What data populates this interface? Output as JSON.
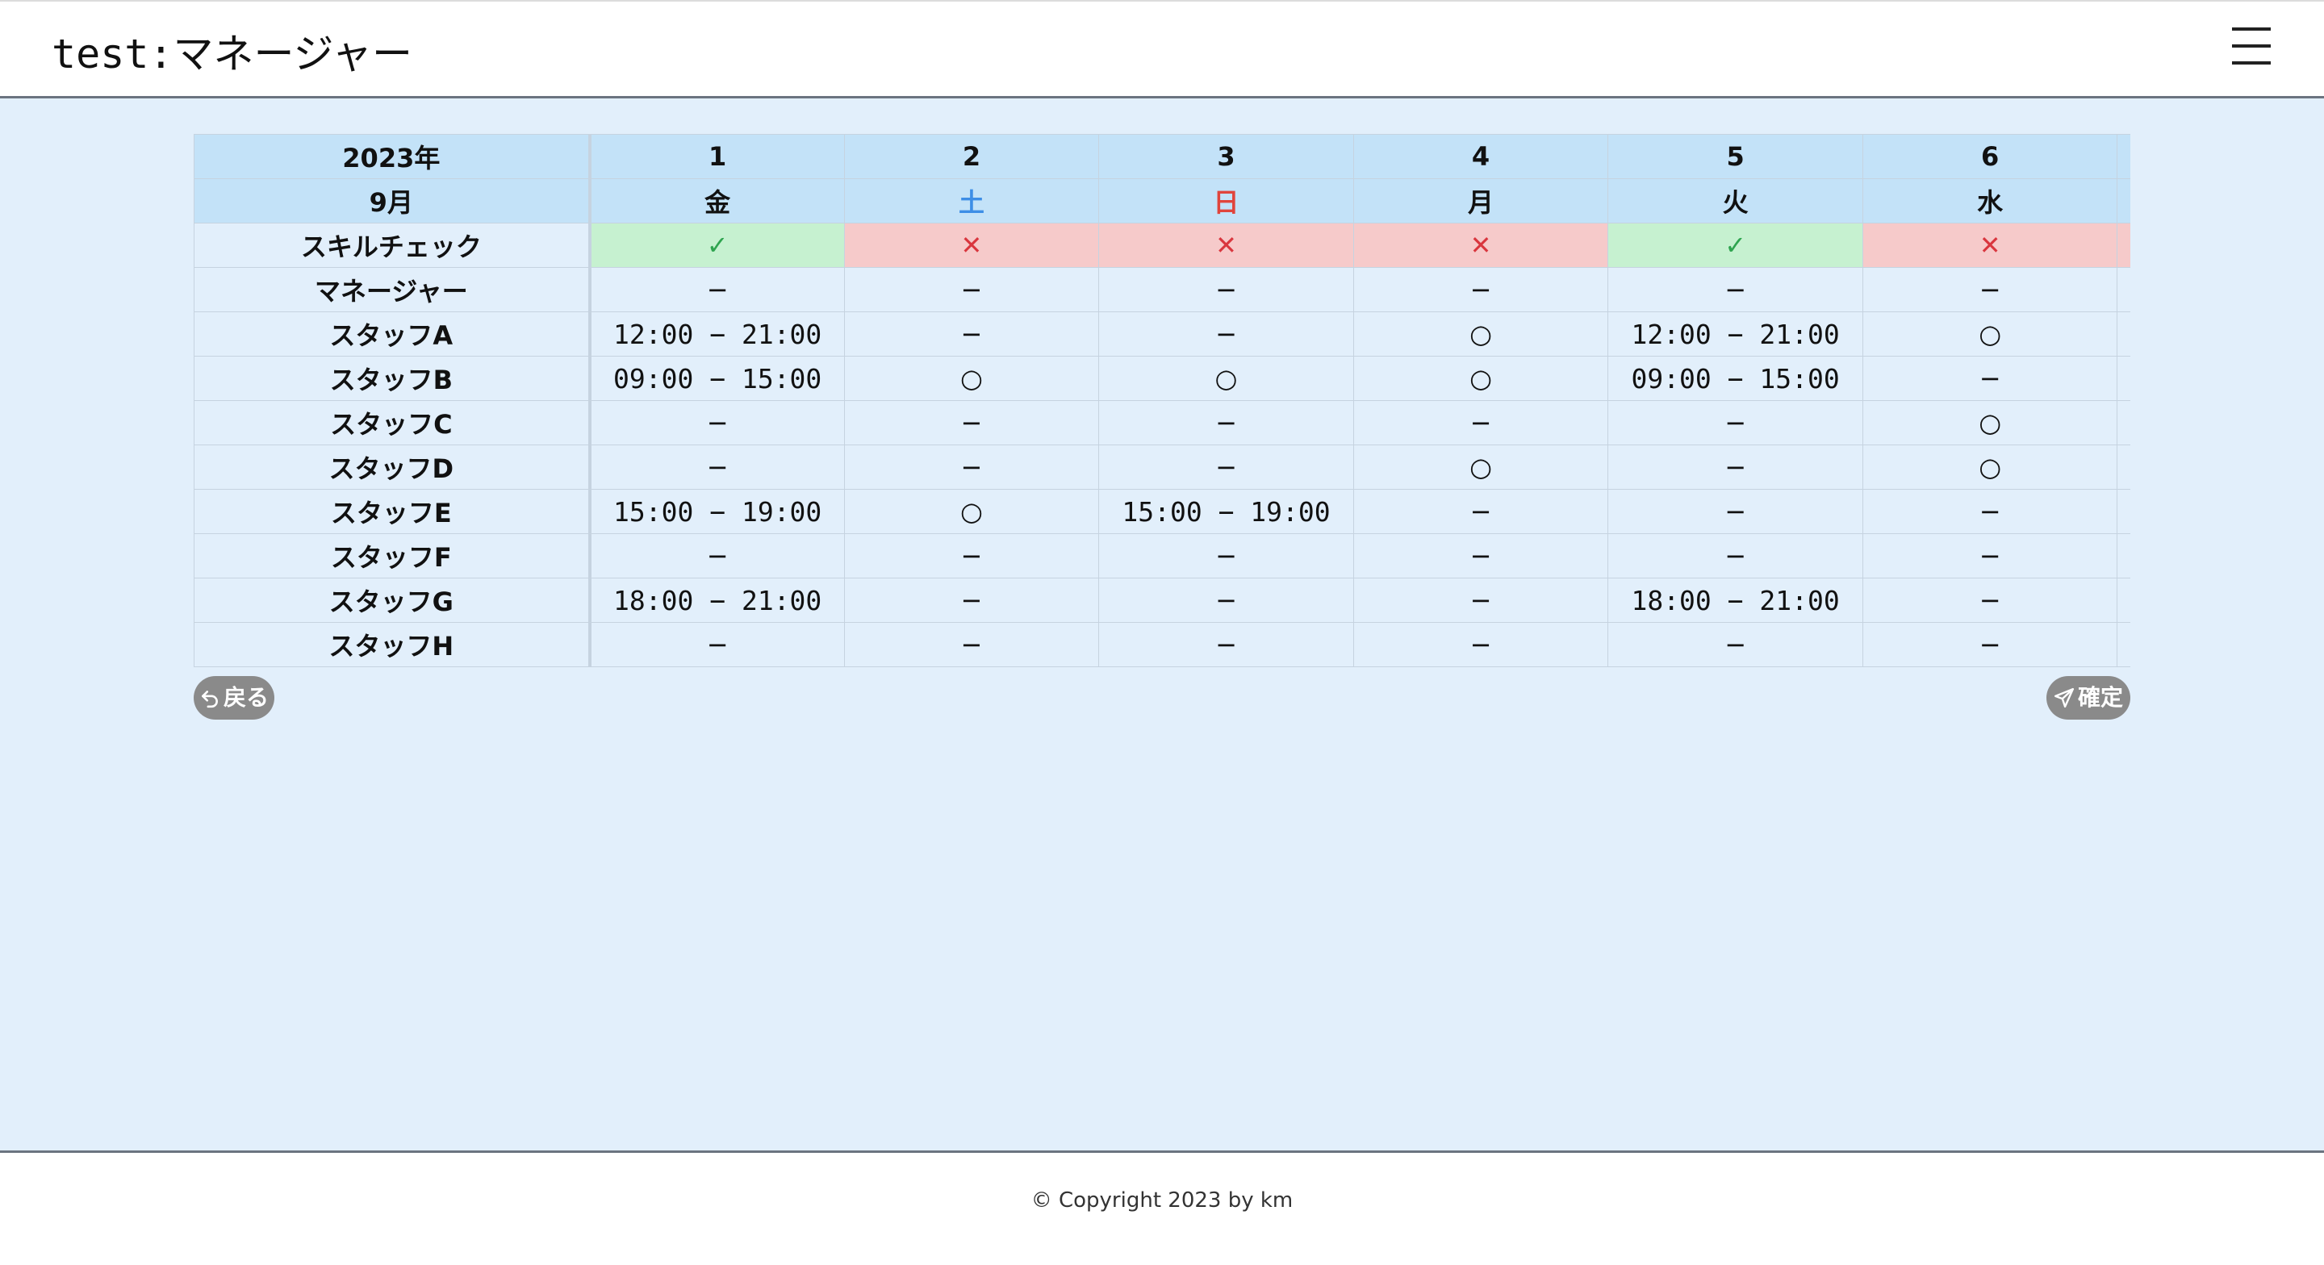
{
  "header": {
    "title": "test:マネージャー",
    "menu_icon": "hamburger-menu-icon"
  },
  "table": {
    "year": "2023年",
    "month": "9月",
    "days": [
      {
        "date": "1",
        "weekday": "金",
        "weekday_type": "weekday"
      },
      {
        "date": "2",
        "weekday": "土",
        "weekday_type": "saturday"
      },
      {
        "date": "3",
        "weekday": "日",
        "weekday_type": "sunday"
      },
      {
        "date": "4",
        "weekday": "月",
        "weekday_type": "weekday"
      },
      {
        "date": "5",
        "weekday": "火",
        "weekday_type": "weekday"
      },
      {
        "date": "6",
        "weekday": "水",
        "weekday_type": "weekday"
      },
      {
        "date": "",
        "weekday": "",
        "weekday_type": "weekday"
      }
    ],
    "skill_check": {
      "label": "スキルチェック",
      "values": [
        "✓",
        "✕",
        "✕",
        "✕",
        "✓",
        "✕",
        ""
      ],
      "status": [
        "ok",
        "ng",
        "ng",
        "ng",
        "ok",
        "ng",
        "ng"
      ]
    },
    "staff": [
      {
        "name": "マネージャー",
        "shifts": [
          "−",
          "−",
          "−",
          "−",
          "−",
          "−",
          ""
        ]
      },
      {
        "name": "スタッフA",
        "shifts": [
          "12:00 − 21:00",
          "−",
          "−",
          "○",
          "12:00 − 21:00",
          "○",
          ""
        ]
      },
      {
        "name": "スタッフB",
        "shifts": [
          "09:00 − 15:00",
          "○",
          "○",
          "○",
          "09:00 − 15:00",
          "−",
          ""
        ]
      },
      {
        "name": "スタッフC",
        "shifts": [
          "−",
          "−",
          "−",
          "−",
          "−",
          "○",
          ""
        ]
      },
      {
        "name": "スタッフD",
        "shifts": [
          "−",
          "−",
          "−",
          "○",
          "−",
          "○",
          ""
        ]
      },
      {
        "name": "スタッフE",
        "shifts": [
          "15:00 − 19:00",
          "○",
          "15:00 − 19:00",
          "−",
          "−",
          "−",
          ""
        ]
      },
      {
        "name": "スタッフF",
        "shifts": [
          "−",
          "−",
          "−",
          "−",
          "−",
          "−",
          ""
        ]
      },
      {
        "name": "スタッフG",
        "shifts": [
          "18:00 − 21:00",
          "−",
          "−",
          "−",
          "18:00 − 21:00",
          "−",
          ""
        ]
      },
      {
        "name": "スタッフH",
        "shifts": [
          "−",
          "−",
          "−",
          "−",
          "−",
          "−",
          ""
        ]
      }
    ]
  },
  "actions": {
    "back_label": "戻る",
    "back_icon": "undo-arrow-icon",
    "confirm_label": "確定",
    "confirm_icon": "send-icon"
  },
  "colors": {
    "ok": "#c6f1d0",
    "ng": "#f6caca",
    "saturday": "#3d8ee6",
    "sunday": "#e0443c"
  },
  "footer": {
    "copyright": "© Copyright 2023 by km"
  }
}
